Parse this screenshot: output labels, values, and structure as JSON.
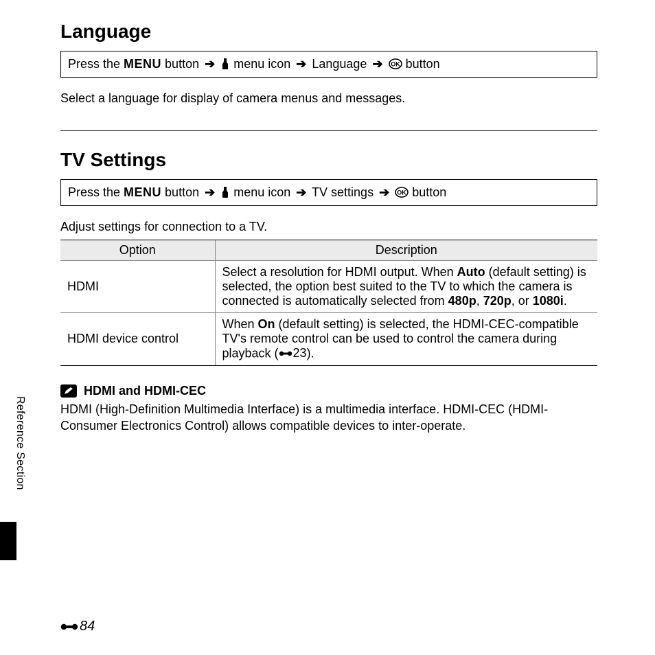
{
  "section1": {
    "heading": "Language",
    "nav": {
      "prefix": "Press the ",
      "menu": "MENU",
      "after_menu": " button ",
      "menu_icon_label": " menu icon ",
      "item": " Language ",
      "ok_suffix": " button"
    },
    "desc": "Select a language for display of camera menus and messages."
  },
  "section2": {
    "heading": "TV Settings",
    "nav": {
      "prefix": "Press the ",
      "menu": "MENU",
      "after_menu": " button ",
      "menu_icon_label": " menu icon ",
      "item": " TV settings ",
      "ok_suffix": " button"
    },
    "desc": "Adjust settings for connection to a TV.",
    "table": {
      "headers": [
        "Option",
        "Description"
      ],
      "rows": [
        {
          "option": "HDMI",
          "desc_parts": {
            "p1": "Select a resolution for HDMI output. When ",
            "b1": "Auto",
            "p2": " (default setting) is selected, the option best suited to the TV to which the camera is connected is automatically selected from ",
            "b2": "480p",
            "p3": ", ",
            "b3": "720p",
            "p4": ", or ",
            "b4": "1080i",
            "p5": "."
          }
        },
        {
          "option": "HDMI device control",
          "desc_parts": {
            "p1": "When ",
            "b1": "On",
            "p2": " (default setting) is selected, the HDMI-CEC-compatible TV's remote control can be used to control the camera during playback (",
            "ref": "23",
            "p3": ")."
          }
        }
      ]
    },
    "note": {
      "title": "HDMI and HDMI-CEC",
      "body": "HDMI (High-Definition Multimedia Interface) is a multimedia interface. HDMI-CEC (HDMI-Consumer Electronics Control) allows compatible devices to inter-operate."
    }
  },
  "side_label": "Reference Section",
  "page_number": "84"
}
